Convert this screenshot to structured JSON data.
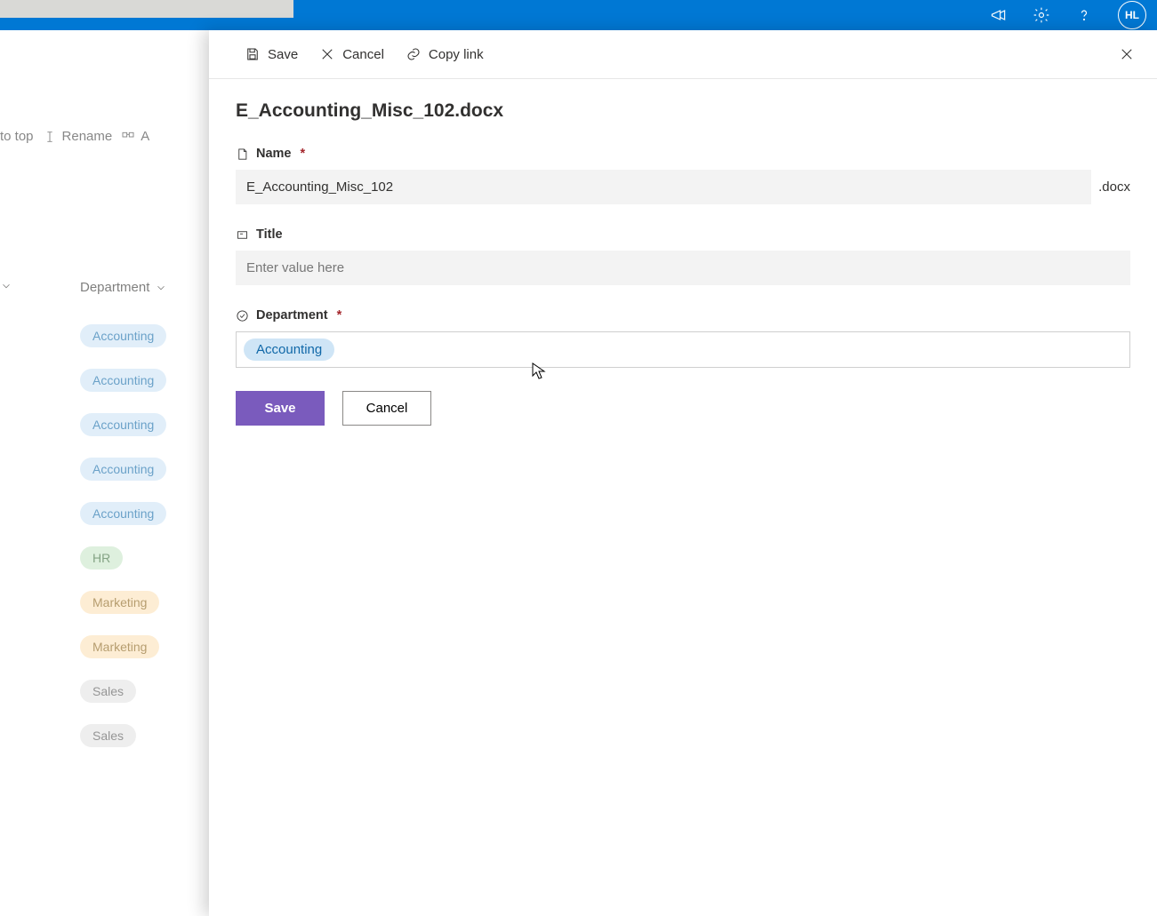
{
  "header": {
    "avatar_initials": "HL"
  },
  "background": {
    "commands": {
      "pin_to_top": "to top",
      "rename": "Rename",
      "automate_prefix": "A"
    },
    "column_header": "Department",
    "rows": [
      {
        "label": "Accounting",
        "tone": "blue"
      },
      {
        "label": "Accounting",
        "tone": "blue"
      },
      {
        "label": "Accounting",
        "tone": "blue"
      },
      {
        "label": "Accounting",
        "tone": "blue"
      },
      {
        "label": "Accounting",
        "tone": "blue"
      },
      {
        "label": "HR",
        "tone": "green"
      },
      {
        "label": "Marketing",
        "tone": "orange"
      },
      {
        "label": "Marketing",
        "tone": "orange"
      },
      {
        "label": "Sales",
        "tone": "grey"
      },
      {
        "label": "Sales",
        "tone": "grey"
      }
    ]
  },
  "panel": {
    "toolbar": {
      "save": "Save",
      "cancel": "Cancel",
      "copy_link": "Copy link"
    },
    "title": "E_Accounting_Misc_102.docx",
    "fields": {
      "name": {
        "label": "Name",
        "value": "E_Accounting_Misc_102",
        "extension": ".docx"
      },
      "title": {
        "label": "Title",
        "placeholder": "Enter value here",
        "value": ""
      },
      "department": {
        "label": "Department",
        "value": "Accounting"
      }
    },
    "buttons": {
      "save": "Save",
      "cancel": "Cancel"
    }
  }
}
